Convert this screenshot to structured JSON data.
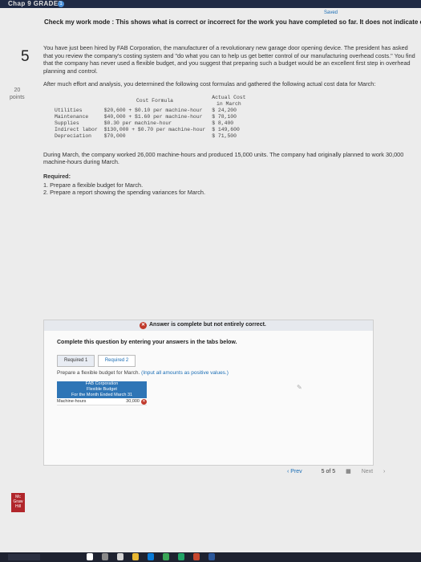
{
  "header": {
    "title": "Chap 9 GRADED",
    "badge": "1",
    "saved": "Saved"
  },
  "banner": "Check my work mode : This shows what is correct or incorrect for the work you have completed so far. It does not indicate c",
  "question": {
    "number": "5",
    "points_value": "20",
    "points_label": "points"
  },
  "problem": {
    "intro": "You have just been hired by FAB Corporation, the manufacturer of a revolutionary new garage door opening device. The president has asked that you review the company's costing system and \"do what you can to help us get better control of our manufacturing overhead costs.\" You find that the company has never used a flexible budget, and you suggest that preparing such a budget would be an excellent first step in overhead planning and control.",
    "analysis": "After much effort and analysis, you determined the following cost formulas and gathered the following actual cost data for March:",
    "table_headers": {
      "formula": "Cost Formula",
      "actual": "Actual Cost",
      "actual2": "in March"
    },
    "rows": [
      {
        "name": "Utilities",
        "formula": "$20,600 + $0.10 per machine-hour",
        "actual": "$ 24,200"
      },
      {
        "name": "Maintenance",
        "formula": "$40,000 + $1.60 per machine-hour",
        "actual": "$ 78,100"
      },
      {
        "name": "Supplies",
        "formula": "$0.30 per machine-hour",
        "actual": "$ 8,400"
      },
      {
        "name": "Indirect labor",
        "formula": "$130,000 + $0.70 per machine-hour",
        "actual": "$ 149,600"
      },
      {
        "name": "Depreciation",
        "formula": "$70,000",
        "actual": "$ 71,500"
      }
    ],
    "during": "During March, the company worked 26,000 machine-hours and produced 15,000 units. The company had originally planned to work 30,000 machine-hours during March.",
    "required_title": "Required:",
    "required": [
      "1. Prepare a flexible budget for March.",
      "2. Prepare a report showing the spending variances for March."
    ]
  },
  "answer": {
    "status": "Answer is complete but not entirely correct.",
    "instruction": "Complete this question by entering your answers in the tabs below.",
    "tabs": [
      "Required 1",
      "Required 2"
    ],
    "prepare": "Prepare a flexible budget for March.",
    "prepare_hint": "(Input all amounts as positive values.)",
    "budget_title1": "FAB Corporation",
    "budget_title2": "Flexible Budget",
    "budget_title3": "For the Month Ended March 31",
    "budget_row_label": "Machine-hours",
    "budget_row_value": "30,000"
  },
  "nav": {
    "prev": "Prev",
    "pages": "5 of 5",
    "next": "Next"
  },
  "logo_text": "Mc Graw Hill Education"
}
